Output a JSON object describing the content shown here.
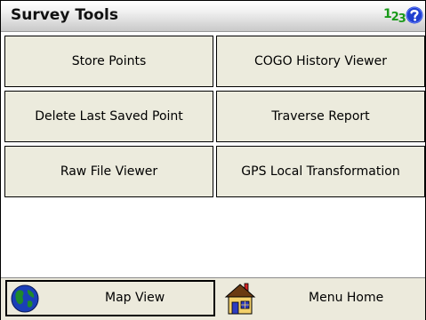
{
  "header": {
    "title": "Survey Tools",
    "numeric_input_icon": "numeric-keypad-icon",
    "numeric_text": {
      "a": "1",
      "b": "2",
      "c": "3"
    },
    "help_icon": "help-icon"
  },
  "buttons": [
    {
      "label": "Store Points"
    },
    {
      "label": "COGO History Viewer"
    },
    {
      "label": "Delete Last Saved Point"
    },
    {
      "label": "Traverse Report"
    },
    {
      "label": "Raw File Viewer"
    },
    {
      "label": "GPS Local Transformation"
    }
  ],
  "bottom": {
    "left": {
      "label": "Map View",
      "icon": "globe-icon"
    },
    "right": {
      "label": "Menu Home",
      "icon": "house-icon"
    }
  },
  "colors": {
    "button_bg": "#ecebdd",
    "numeric_green": "#1a9a1a",
    "help_blue": "#1f3fd0"
  }
}
